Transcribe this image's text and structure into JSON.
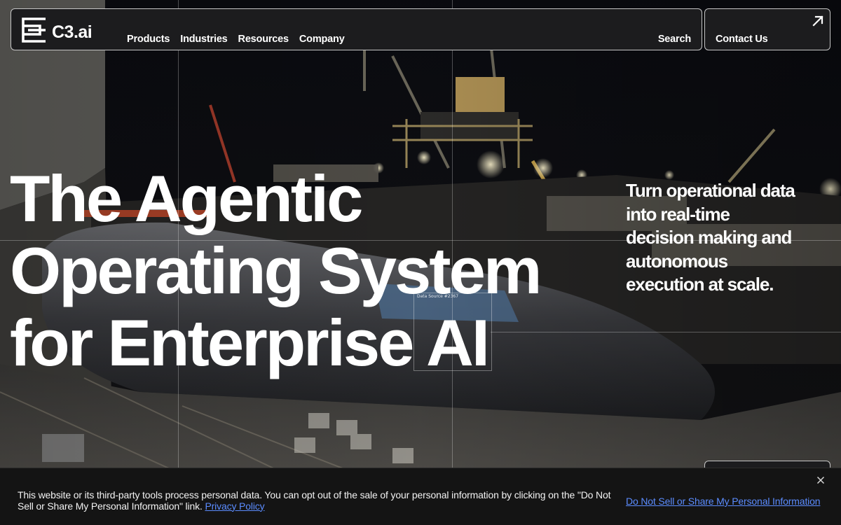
{
  "brand": {
    "logo_text": "C3.ai"
  },
  "nav": {
    "links": [
      "Products",
      "Industries",
      "Resources",
      "Company"
    ],
    "search_label": "Search",
    "contact_label": "Contact Us"
  },
  "hero": {
    "title_lines": [
      "The Agentic",
      "Operating System",
      "for Enterprise AI"
    ],
    "subtitle": "Turn operational data into real-time decision making and autonomous execution at scale.",
    "data_source_label": "Data Source #2367"
  },
  "cookie": {
    "text": "This website or its third-party tools process personal data. You can opt out of the sale of your personal information by clicking on the \"Do Not Sell or Share My Personal Information\" link.",
    "privacy_link": "Privacy Policy",
    "optout_link": "Do Not Sell or Share My Personal Information"
  },
  "icons": {
    "logo": "c3-logo-icon",
    "contact": "arrow-up-right-icon",
    "close": "close-icon"
  },
  "colors": {
    "nav_bg": "#1c1c1e",
    "link_blue": "#5b8cff",
    "banner_bg": "#141414"
  }
}
